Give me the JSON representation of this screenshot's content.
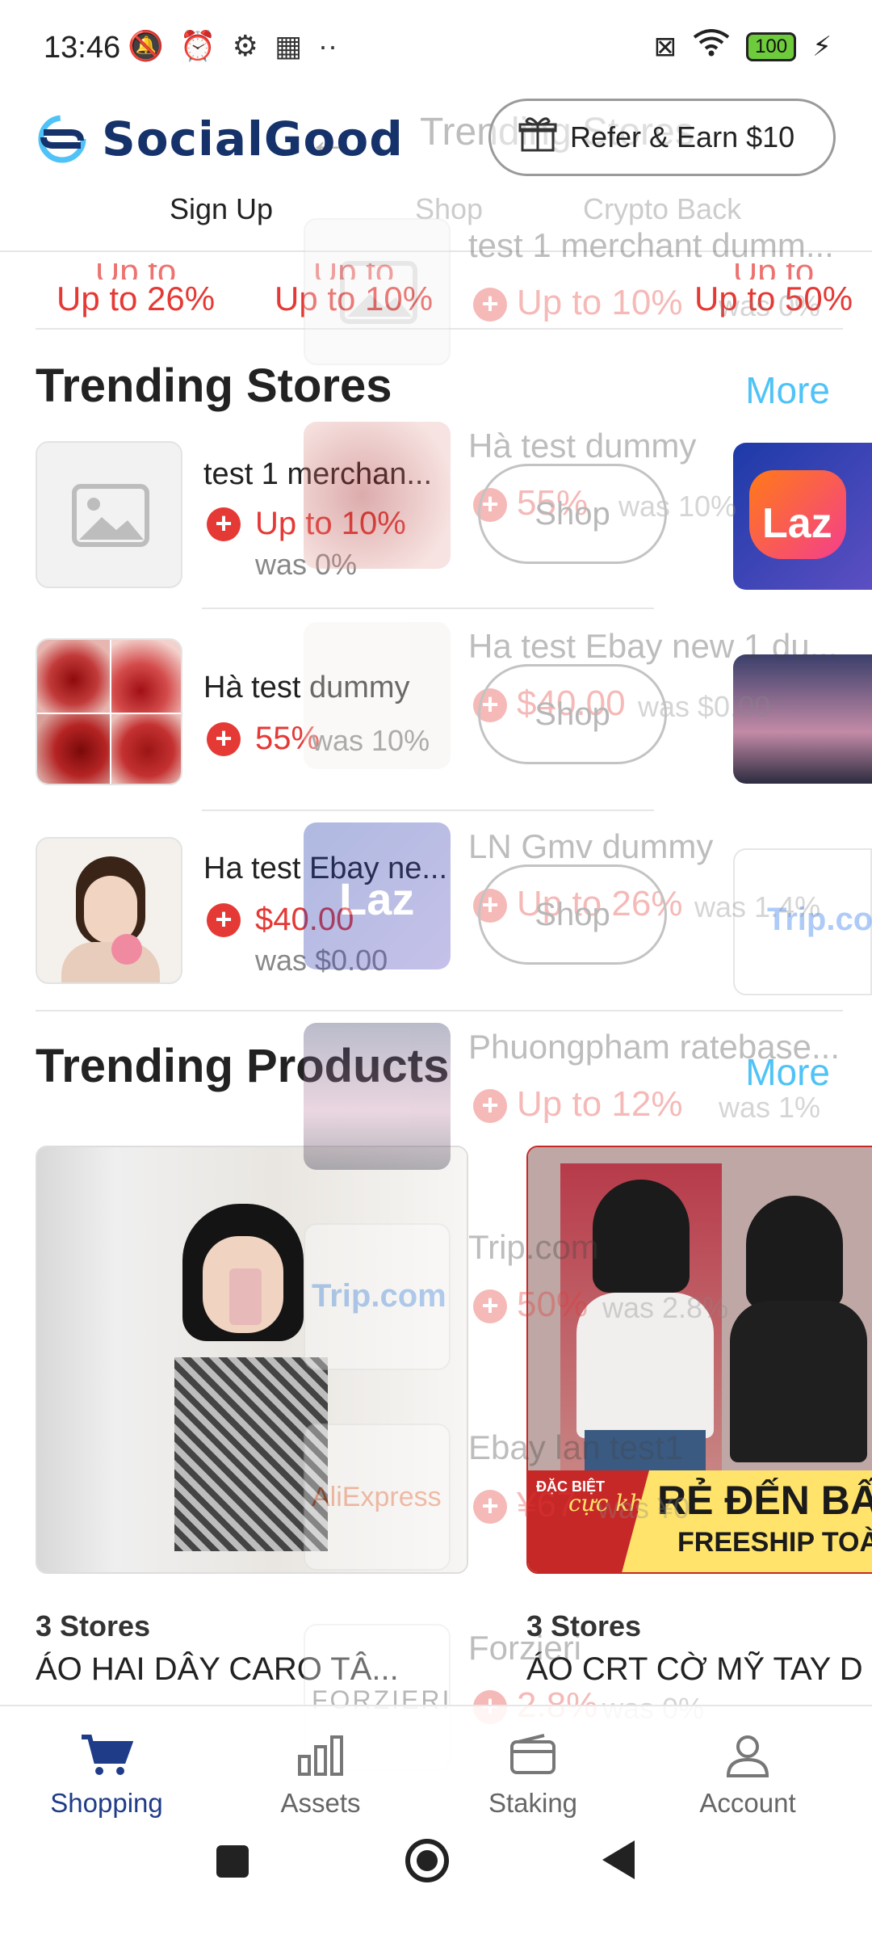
{
  "status_bar": {
    "time": "13:46",
    "battery": "100"
  },
  "header": {
    "brand": "SocialGood",
    "refer_label": "Refer & Earn $10",
    "tabs": [
      "Sign Up",
      "Shop",
      "Crypto Back"
    ],
    "overlay_title": "Trending Stores"
  },
  "top_rates": [
    "Up to\n26%",
    "Up to\n10%",
    "Up to\n50%"
  ],
  "trending_stores": {
    "title": "Trending Stores",
    "more": "More",
    "items": [
      {
        "name": "test 1 merchan...",
        "rate": "Up to 10%",
        "was": "was 0%"
      },
      {
        "name": "Hà test dummy",
        "rate": "55%",
        "was": "was 10%"
      },
      {
        "name": "Ha test Ebay ne...",
        "rate": "$40.00",
        "was": "was $0.00"
      }
    ]
  },
  "overlay_list": {
    "items": [
      {
        "name": "test 1 merchant dumm...",
        "rate": "Up to 10%",
        "was": "was 0%",
        "logo": ""
      },
      {
        "name": "Hà test dummy",
        "rate": "55%",
        "was": "was 10%",
        "logo": ""
      },
      {
        "name": "Ha test Ebay new 1 du...",
        "rate": "$40.00",
        "was": "was $0.00",
        "logo": ""
      },
      {
        "name": "LN Gmv dummy",
        "rate": "Up to 26%",
        "was": "was 1.4%",
        "logo": "Laz"
      },
      {
        "name": "Phuongpham ratebase...",
        "rate": "Up to 12%",
        "was": "was 1%",
        "logo": ""
      },
      {
        "name": "Trip.com",
        "rate": "50%",
        "was": "was 2.8%",
        "logo": "Trip.com"
      },
      {
        "name": "Ebay lan test1",
        "rate": "¥67",
        "was": "was ¥0",
        "logo": "AliExpress"
      },
      {
        "name": "Forzieri",
        "rate": "2.8%",
        "was": "was 0%",
        "logo": "FORZIERI"
      }
    ],
    "shop_label": "Shop"
  },
  "trending_products": {
    "title": "Trending Products",
    "more": "More",
    "items": [
      {
        "stores": "3 Stores",
        "name": "ÁO HAI DÂY CARO TÂ..."
      },
      {
        "stores": "3 Stores",
        "name": "ÁO CRT CỜ MỸ TAY D"
      }
    ],
    "banner_big": "RẺ ĐẾN BẤT",
    "banner_small": "FREESHIP TOÀN",
    "banner_tag": "ĐẶC BIỆT",
    "banner_script": "cực khủng"
  },
  "right_logos": [
    "Laz",
    "Trip.com"
  ],
  "bottom_nav": [
    {
      "label": "Shopping",
      "icon": "cart-icon"
    },
    {
      "label": "Assets",
      "icon": "bar-chart-icon"
    },
    {
      "label": "Staking",
      "icon": "wallet-icon"
    },
    {
      "label": "Account",
      "icon": "person-icon"
    }
  ],
  "colors": {
    "accent": "#e53935",
    "brand": "#16326b",
    "link": "#4fc3f7",
    "nav_active": "#1f3c88"
  }
}
